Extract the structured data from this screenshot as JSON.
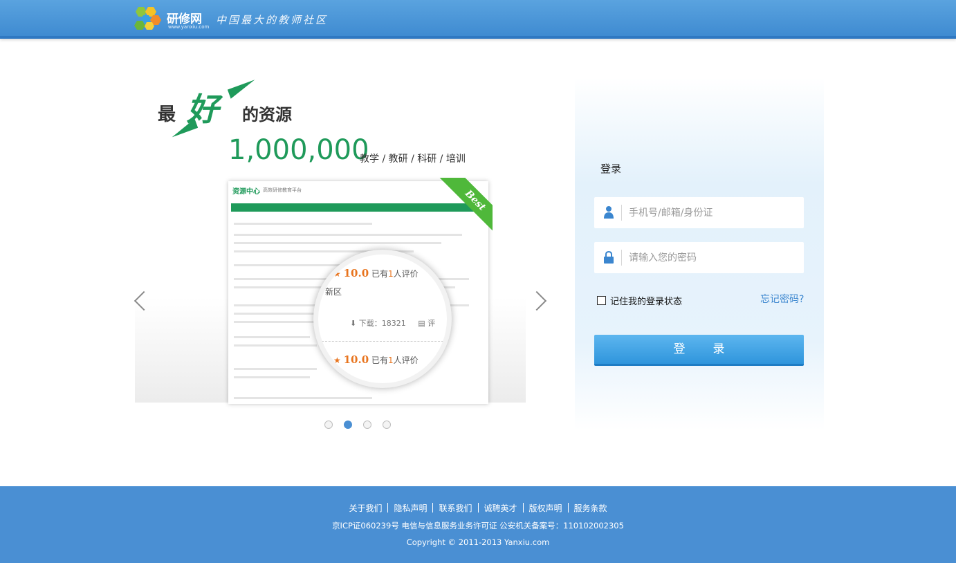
{
  "header": {
    "logo_name": "研修网",
    "logo_url": "www.yanxiu.com",
    "slogan": "中国最大的教师社区"
  },
  "hero": {
    "best": "最",
    "good": "好",
    "rest": "的资源",
    "count": "1,000,000",
    "categories": "教学 / 教研 / 科研 / 培训"
  },
  "preview": {
    "title": "资源中心",
    "subtitle": "高效研修教育平台",
    "ribbon": "Best",
    "lens": {
      "score": "10.0",
      "rating_text_a": "已有",
      "rating_count": "1",
      "rating_text_b": "人评价",
      "region_text": "新区",
      "downloads": "下载：18321",
      "comment_partial": "评"
    }
  },
  "carousel": {
    "dots": 4,
    "active_index": 1
  },
  "login": {
    "title": "登录",
    "username_placeholder": "手机号/邮箱/身份证",
    "password_placeholder": "请输入您的密码",
    "remember_label": "记住我的登录状态",
    "forgot_label": "忘记密码?",
    "submit_label": "登录"
  },
  "footer": {
    "links": [
      "关于我们",
      "隐私声明",
      "联系我们",
      "诚聘英才",
      "版权声明",
      "服务条款"
    ],
    "icp": "京ICP证060239号 电信与信息服务业务许可证 公安机关备案号：110102002305",
    "copyright": "Copyright © 2011-2013 Yanxiu.com"
  },
  "colors": {
    "header_blue": "#4a8fd3",
    "brand_green": "#1f9a5a",
    "button_blue": "#2f95dc",
    "link_blue": "#3b86cf"
  }
}
